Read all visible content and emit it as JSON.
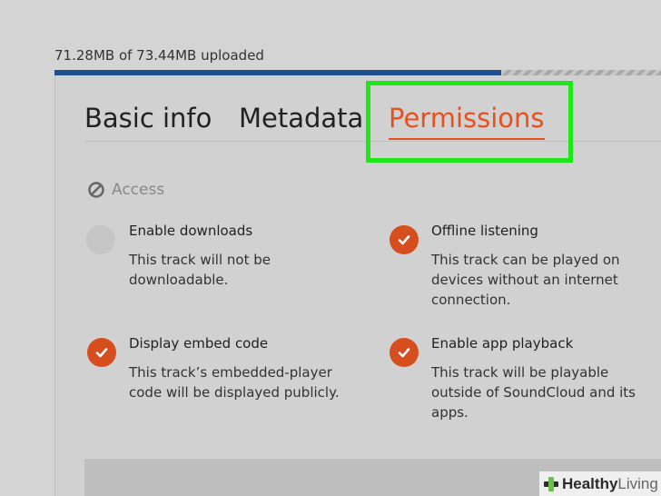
{
  "upload": {
    "status_text": "71.28MB of 73.44MB uploaded",
    "progress_fraction": 0.737
  },
  "tabs": [
    {
      "label": "Basic info"
    },
    {
      "label": "Metadata"
    },
    {
      "label": "Permissions",
      "active": true
    }
  ],
  "section": {
    "title": "Access",
    "icon": "no-entry-icon"
  },
  "permissions": [
    {
      "title": "Enable downloads",
      "description": "This track will not be downloadable.",
      "enabled": false
    },
    {
      "title": "Offline listening",
      "description": "This track can be played on devices without an internet connection.",
      "enabled": true
    },
    {
      "title": "Display embed code",
      "description": "This track’s embedded-player code will be displayed publicly.",
      "enabled": true
    },
    {
      "title": "Enable app playback",
      "description": "This track will be playable outside of SoundCloud and its apps.",
      "enabled": true
    }
  ],
  "watermark": {
    "text_bold": "Healthy",
    "text_regular": "Living"
  },
  "colors": {
    "accent": "#e8501e",
    "check": "#d64e1e",
    "progress": "#1f4f8f",
    "highlight": "#1ee81a"
  }
}
